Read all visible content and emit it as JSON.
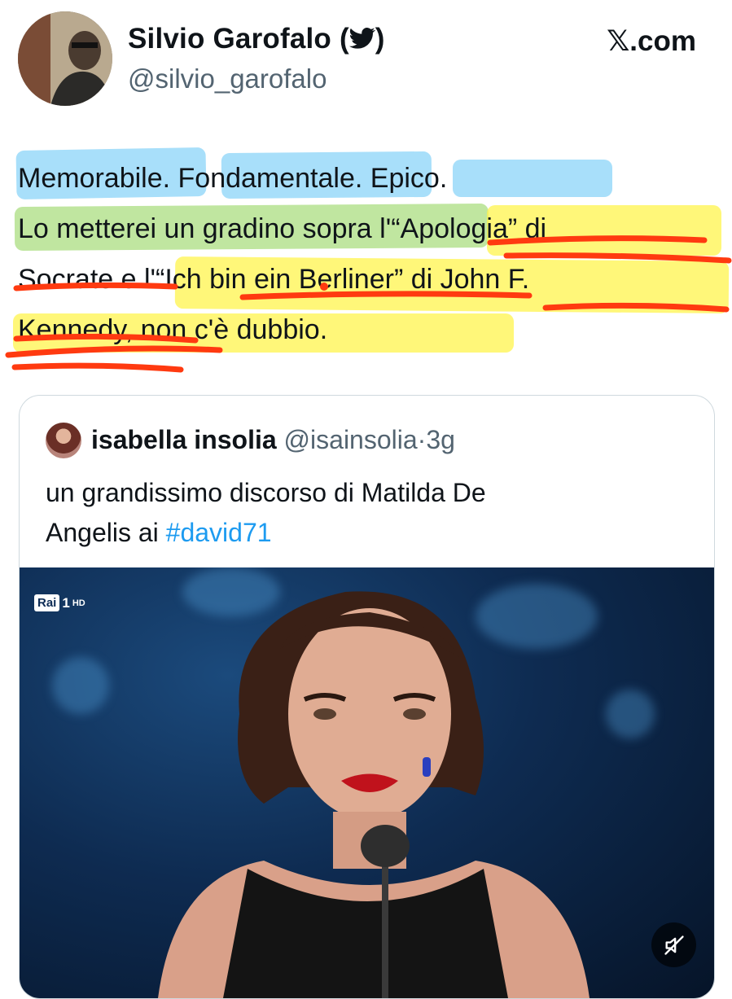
{
  "author": {
    "name": "Silvio Garofalo",
    "handle": "@silvio_garofalo",
    "verified_icon": "twitter-bird-icon"
  },
  "source_brand": "𝕏.com",
  "tweet": {
    "lines": [
      "Memorabile. Fondamentale. Epico.",
      "Lo metterei un gradino sopra l'“Apologia” di",
      "Socrate e  l'“Ich bin ein Berliner” di John F.",
      "Kennedy, non c'è dubbio."
    ]
  },
  "quoted": {
    "name": "isabella insolia",
    "handle": "@isainsolia",
    "separator": "·",
    "time": "3g",
    "text_line1": "un grandissimo discorso di Matilda De",
    "text_line2_prefix": "Angelis ai ",
    "hashtag": "#david71",
    "media": {
      "channel_logo_box": "Rai",
      "channel_logo_num": "1",
      "channel_logo_hd": "HD",
      "mute_icon": "speaker-muted-icon"
    }
  },
  "colors": {
    "highlight_blue": "#60c4f5",
    "highlight_green": "#96d660",
    "highlight_yellow": "#fff44c",
    "ink_red": "#ff3a10",
    "link_blue": "#1d9bf0",
    "muted_gray": "#536471"
  }
}
